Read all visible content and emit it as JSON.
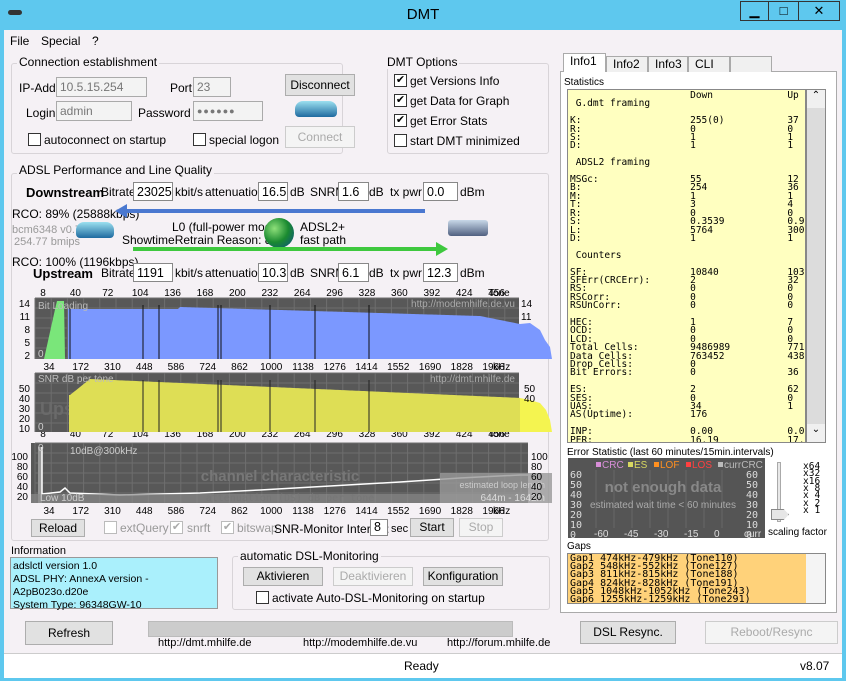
{
  "window": {
    "title": "DMT",
    "min": "▁",
    "max": "□",
    "close": "✕"
  },
  "menu": [
    "File",
    "Special",
    "?"
  ],
  "connection": {
    "legend": "Connection establishment",
    "ip_label": "IP-Add.",
    "ip": "10.5.15.254",
    "port_label": "Port",
    "port": "23",
    "login_label": "Login",
    "login": "admin",
    "password_label": "Password",
    "password": "●●●●●●",
    "disconnect": "Disconnect",
    "connect": "Connect",
    "autoconnect": "autoconnect on startup",
    "special_logon": "special logon"
  },
  "options": {
    "legend": "DMT Options",
    "items": [
      {
        "label": "get Versions Info",
        "checked": true
      },
      {
        "label": "get Data for Graph",
        "checked": true
      },
      {
        "label": "get Error Stats",
        "checked": true
      },
      {
        "label": "start DMT minimized",
        "checked": false
      }
    ]
  },
  "perf": {
    "legend": "ADSL Performance and Line Quality",
    "down": {
      "label": "Downstream",
      "bitrate": "23025",
      "attenuation": "16.5",
      "snrm": "1.6",
      "txpwr": "0.0",
      "rco": "RCO: 89% (25888kbps)"
    },
    "up": {
      "label": "Upstream",
      "bitrate": "1191",
      "attenuation": "10.3",
      "snrm": "6.1",
      "txpwr": "12.3",
      "rco": "RCO: 100% (1196kbps)"
    },
    "bitrate_label": "Bitrate",
    "kbits": "kbit/s",
    "att_label": "attenuation",
    "db": "dB",
    "snrm_label": "SNRM",
    "txpwr_label": "tx pwr",
    "dbm": "dBm",
    "chip": "bcm6348 v0.7",
    "bmips": "254.77 bmips",
    "mode": "L0 (full-power mode)",
    "retrain": "ShowtimeRetrain Reason: 8000",
    "adsl": "ADSL2+",
    "path": "fast path"
  },
  "charts": {
    "tones": [
      "8",
      "40",
      "72",
      "104",
      "136",
      "168",
      "200",
      "232",
      "264",
      "296",
      "328",
      "360",
      "392",
      "424",
      "456"
    ],
    "tone_unit": "Tone",
    "khz": [
      "34",
      "172",
      "310",
      "448",
      "586",
      "724",
      "862",
      "1000",
      "1138",
      "1276",
      "1414",
      "1552",
      "1690",
      "1828",
      "1966"
    ],
    "khz_unit": "kHz",
    "bit_y": [
      "14",
      "11",
      "8",
      "5",
      "2"
    ],
    "bit_title": "Bit Loading",
    "bit_url": "http://modemhilfe.de.vu",
    "zero": "0",
    "snr_y": [
      "50",
      "40",
      "30",
      "20",
      "10"
    ],
    "snr_title": "SNR  dB per tone",
    "snr_url": "http://dmt.mhilfe.de",
    "snr_wm": "Upstream",
    "ch_y": [
      "100",
      "80",
      "60",
      "40",
      "20"
    ],
    "ch_note": "10dB@300kHz",
    "ch_title": "channel characteristic",
    "ch_sub": "attenuation (DS)  dB per tone",
    "ch_low": "Low 10dB",
    "loop_label": "estimated loop length",
    "loop": "644m - 1642m",
    "colors": {
      "up_bits": "#7ae67a",
      "down_bits": "#7b98ff",
      "snr_down": "#dede55",
      "snr_up": "#f4f450"
    }
  },
  "controls": {
    "reload": "Reload",
    "extquery": "extQuery",
    "snrft": "snrft",
    "bitswap": "bitswap",
    "interval_label": "SNR-Monitor Interval:",
    "interval": "8",
    "sec": "sec",
    "start": "Start",
    "stop": "Stop"
  },
  "info": {
    "label": "Information",
    "lines": [
      "adslctl version 1.0",
      "ADSL PHY: AnnexA version - A2pB023o.d20e",
      "System Type: 96348GW-10"
    ]
  },
  "auto": {
    "legend": "automatic DSL-Monitoring",
    "activate": "Aktivieren",
    "deactivate": "Deaktivieren",
    "config": "Konfiguration",
    "startup": "activate Auto-DSL-Monitoring on startup"
  },
  "bottom": {
    "refresh": "Refresh",
    "links": [
      "http://dmt.mhilfe.de",
      "http://modemhilfe.de.vu",
      "http://forum.mhilfe.de"
    ],
    "resync": "DSL Resync.",
    "reboot": "Reboot/Resync",
    "progress": 0
  },
  "status": {
    "text": "Ready",
    "version": "v8.07"
  },
  "tabs": [
    "Info1",
    "Info2",
    "Info3",
    "CLI"
  ],
  "stats": {
    "label": "Statistics",
    "text": "                     Down             Up\n G.dmt framing\n\nK:                   255(0)           37\nR:                   0                0\nS:                   1                1\nD:                   1                1\n\n ADSL2 framing\n\nMSGc:                55               12\nB:                   254              36\nM:                   1                1\nT:                   3                4\nR:                   0                0\nS:                   0.3539           0.9866\nL:                   5764             300\nD:                   1                1\n\n Counters\n\nSF:                  10840            10326\nSFErr(CRCErr):       2                32\nRS:                  0                0\nRSCorr:              0                0\nRSUnCorr:            0                0\n\nHEC:                 1                7\nOCD:                 0                0\nLCD:                 0                0\nTotal Cells:         9486989          771784\nData Cells:          763452           43827\nDrop Cells:          0\nBit Errors:          0                36\n\nES:                  2                62\nSES:                 0                0\nUAS:                 34               1\nAS(Uptime):          176\n\nINP:                 0.00             0.00\nPER:                 16.19            17.76\ndelay:               0.08             0.24\nOR:                  30.13            8.10"
  },
  "errors": {
    "label": "Error Statistic (last 60 minutes/15min.intervals)",
    "legend": [
      {
        "name": "CRC",
        "color": "#d88ed8"
      },
      {
        "name": "ES",
        "color": "#d8d860"
      },
      {
        "name": "LOF",
        "color": "#ff9020"
      },
      {
        "name": "LOS",
        "color": "#ff4040"
      },
      {
        "name": "currCRC",
        "color": "#bbbbbb"
      }
    ],
    "y": [
      "60",
      "50",
      "40",
      "30",
      "20",
      "10",
      "0"
    ],
    "x": [
      "-60",
      "-45",
      "-30",
      "-15",
      "0",
      "curr"
    ],
    "msg": "not enough data",
    "wait": "estimated wait time < 60 minutes",
    "scales": [
      "x64",
      "x32",
      "x16",
      "x 8",
      "x 4",
      "x 2",
      "x 1"
    ],
    "scale_label": "scaling factor",
    "scale_value": "x 1"
  },
  "gaps": {
    "label": "Gaps",
    "items": [
      "Gap1 474kHz-479kHz (Tone110)",
      "Gap2 548kHz-552kHz (Tone127)",
      "Gap3 811kHz-815kHz (Tone188)",
      "Gap4 824kHz-828kHz (Tone191)",
      "Gap5 1048kHz-1052kHz (Tone243)",
      "Gap6 1255kHz-1259kHz (Tone291)"
    ]
  }
}
